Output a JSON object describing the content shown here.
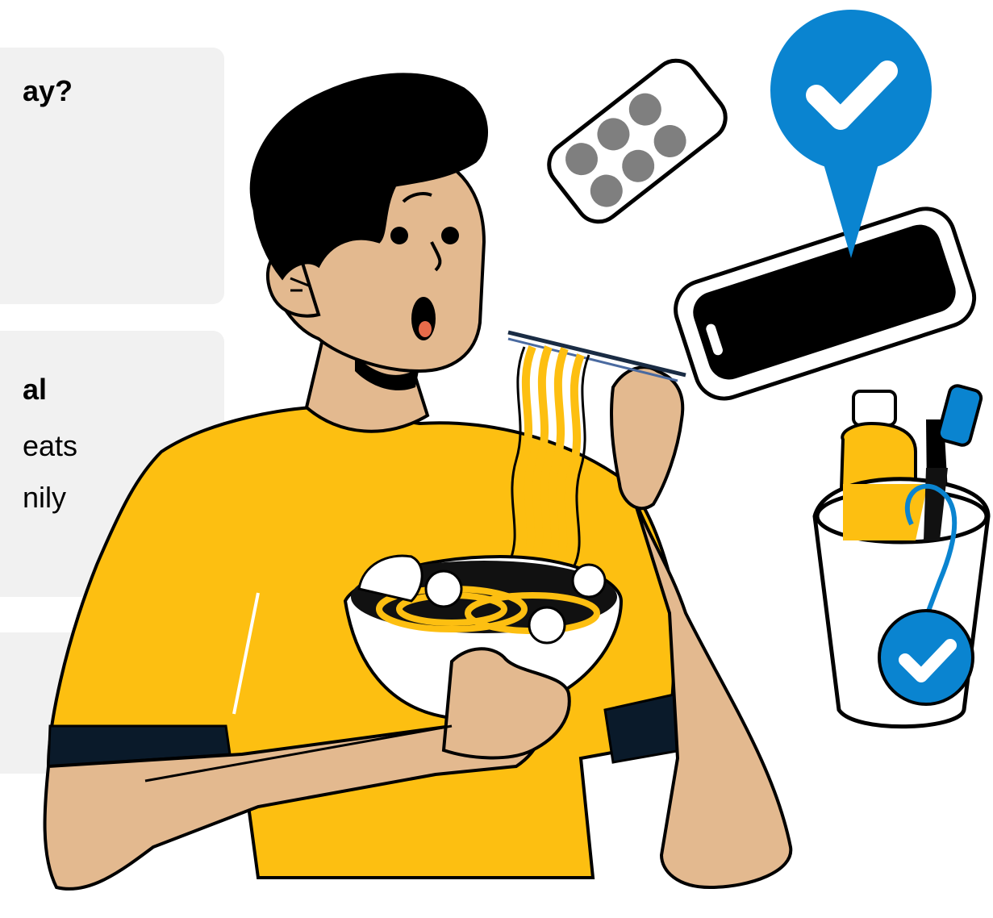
{
  "cards": [
    {
      "lines": [
        "ay?"
      ],
      "bold_lines": [
        0
      ]
    },
    {
      "lines": [
        "al",
        "eats",
        "nily"
      ],
      "bold_lines": [
        0
      ]
    },
    {
      "lines": [],
      "bold_lines": []
    }
  ],
  "colors": {
    "shirt": "#fdbf11",
    "skin": "#e3b98f",
    "hair": "#000000",
    "accent_blue": "#0a84d0",
    "card_bg": "#f1f1f1",
    "pill_gray": "#7f7f7f",
    "sleeve_dark": "#0a1a2a"
  },
  "icons": [
    "check-pin-icon",
    "pill-pack-icon",
    "smartphone-icon",
    "check-badge-icon"
  ]
}
